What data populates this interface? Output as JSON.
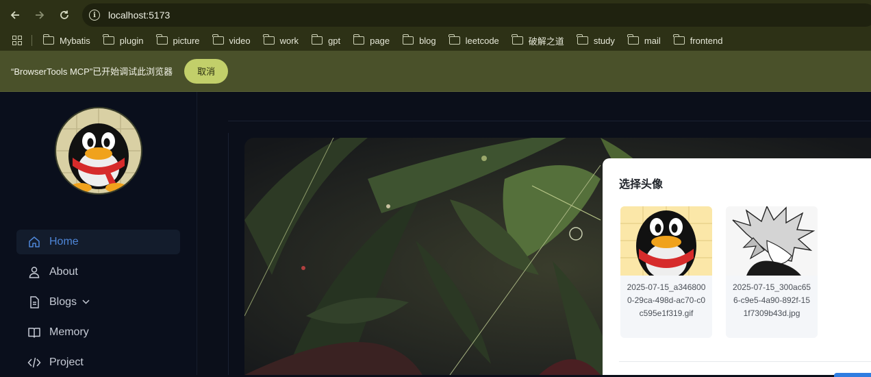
{
  "browser": {
    "url": "localhost:5173",
    "nav": {
      "back_icon": "arrow-left-icon",
      "forward_icon": "arrow-right-icon",
      "reload_icon": "reload-icon"
    },
    "bookmarks": [
      "Mybatis",
      "plugin",
      "picture",
      "video",
      "work",
      "gpt",
      "page",
      "blog",
      "leetcode",
      "破解之道",
      "study",
      "mail",
      "frontend"
    ],
    "infobar": {
      "message": "“BrowserTools MCP”已开始调试此浏览器",
      "cancel_label": "取消"
    }
  },
  "sidebar": {
    "nav": [
      {
        "label": "Home",
        "icon": "home-icon",
        "active": true
      },
      {
        "label": "About",
        "icon": "user-icon"
      },
      {
        "label": "Blogs",
        "icon": "document-icon",
        "has_dropdown": true
      },
      {
        "label": "Memory",
        "icon": "book-icon"
      },
      {
        "label": "Project",
        "icon": "code-icon"
      }
    ]
  },
  "modal": {
    "title": "选择头像",
    "avatars": [
      {
        "filename": "2025-07-15_a3468000-29ca-498d-ac70-c0c595e1f319.gif"
      },
      {
        "filename": "2025-07-15_300ac656-c9e5-4a90-892f-151f7309b43d.jpg"
      }
    ]
  },
  "colors": {
    "accent": "#4e86d8",
    "browser_chrome": "#2d3116",
    "infobar": "#4a512a",
    "cancel_button": "#c2cf6a"
  }
}
